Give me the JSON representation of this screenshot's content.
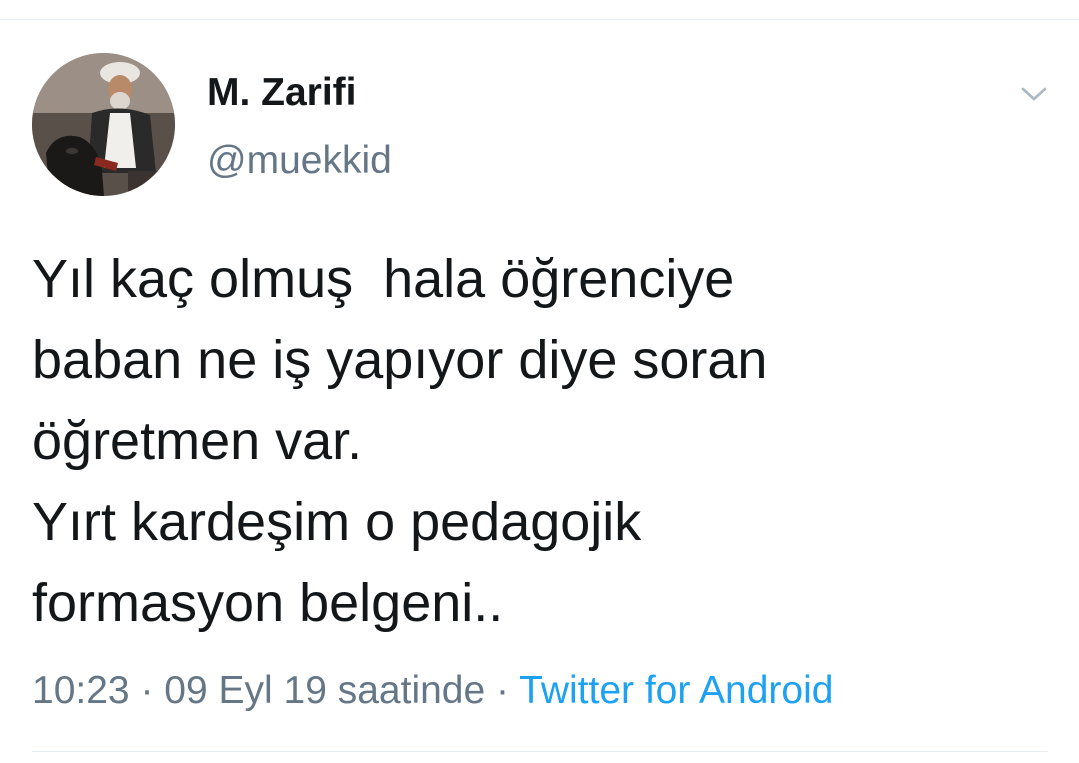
{
  "user": {
    "display_name": "M. Zarifi",
    "username": "@muekkid",
    "avatar_icon": "profile-photo"
  },
  "menu": {
    "caret_icon": "chevron-down-icon"
  },
  "tweet": {
    "text": "Yıl kaç olmuş  hala öğrenciye\nbaban ne iş yapıyor diye soran\nöğretmen var.\nYırt kardeşim o pedagojik\nformasyon belgeni..",
    "time": "10:23",
    "separator": " · ",
    "date_text": "09 Eyl 19 saatinde",
    "source": "Twitter for Android"
  },
  "colors": {
    "text": "#14171a",
    "secondary": "#657786",
    "link": "#1da1f2",
    "divider": "#e6ecf0"
  }
}
